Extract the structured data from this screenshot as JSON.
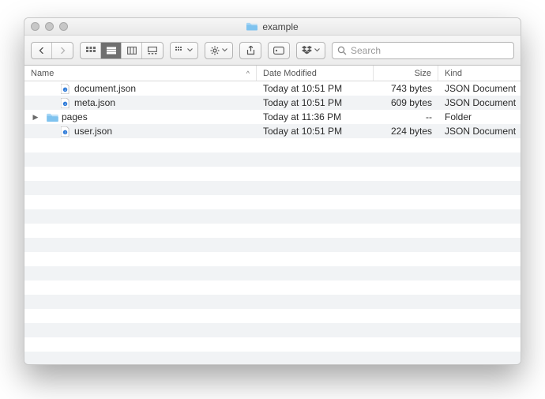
{
  "window": {
    "title": "example"
  },
  "toolbar": {
    "search_placeholder": "Search"
  },
  "columns": {
    "name": "Name",
    "date": "Date Modified",
    "size": "Size",
    "kind": "Kind",
    "sort_indicator": "^"
  },
  "files": [
    {
      "icon": "json",
      "disclosure": "",
      "name": "document.json",
      "date": "Today at 10:51 PM",
      "size": "743 bytes",
      "kind": "JSON Document"
    },
    {
      "icon": "json",
      "disclosure": "",
      "name": "meta.json",
      "date": "Today at 10:51 PM",
      "size": "609 bytes",
      "kind": "JSON Document"
    },
    {
      "icon": "folder",
      "disclosure": "▶",
      "name": "pages",
      "date": "Today at 11:36 PM",
      "size": "--",
      "kind": "Folder"
    },
    {
      "icon": "json",
      "disclosure": "",
      "name": "user.json",
      "date": "Today at 10:51 PM",
      "size": "224 bytes",
      "kind": "JSON Document"
    }
  ],
  "blank_rows": 18
}
